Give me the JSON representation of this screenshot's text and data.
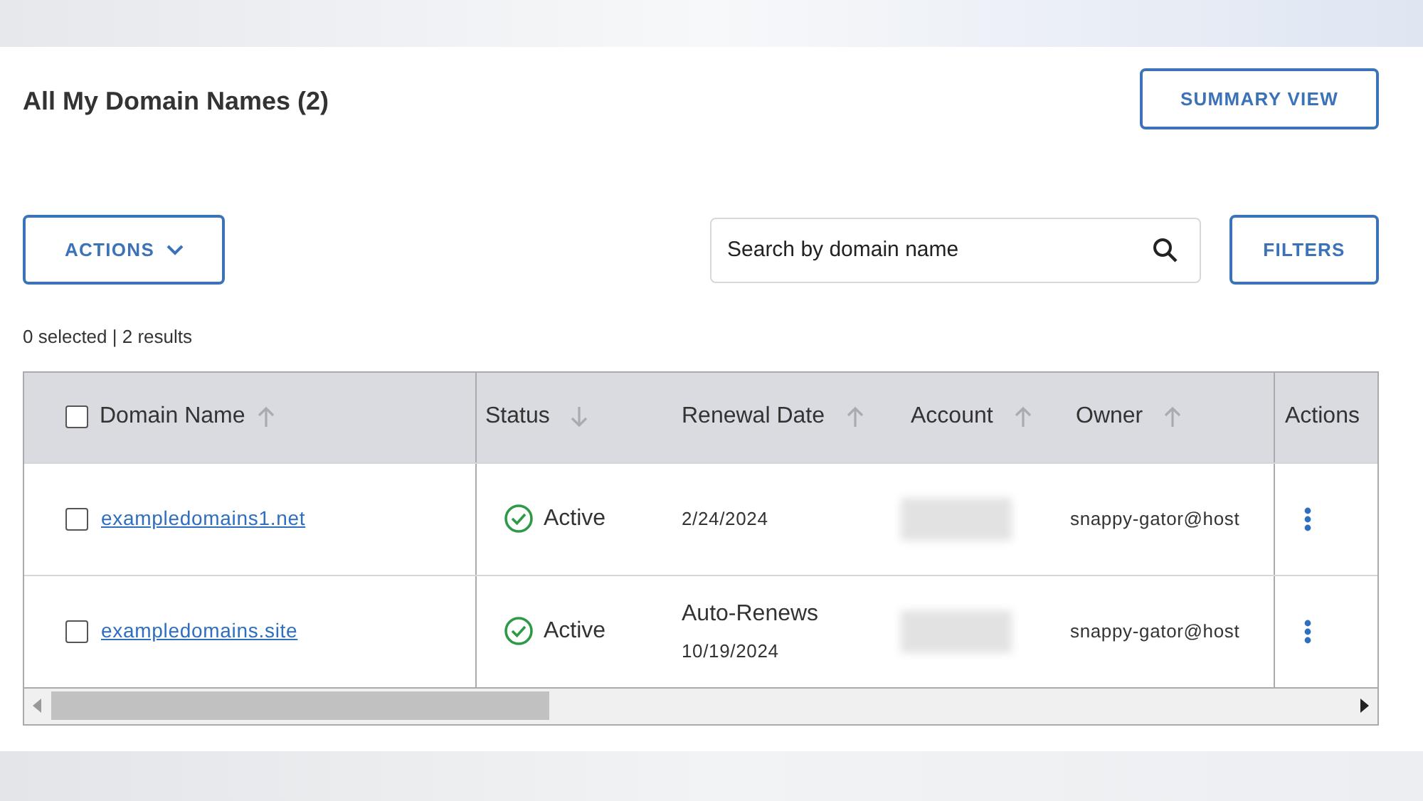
{
  "header": {
    "title": "All My Domain Names (2)",
    "summary_button": "SUMMARY VIEW"
  },
  "toolbar": {
    "actions_button": "ACTIONS",
    "search": {
      "placeholder": "Search by domain name"
    },
    "filters_button": "FILTERS"
  },
  "result_summary": "0 selected | 2 results",
  "table": {
    "select_all": {
      "checked": false
    },
    "columns": [
      {
        "label": "Domain Name",
        "sortable": true,
        "descending": false
      },
      {
        "label": "Status",
        "sortable": true,
        "descending": true
      },
      {
        "label": "Renewal Date",
        "sortable": true,
        "descending": false
      },
      {
        "label": "Account",
        "sortable": true,
        "descending": false
      },
      {
        "label": "Owner",
        "sortable": true,
        "descending": false
      },
      {
        "label": "Actions"
      }
    ],
    "rows": [
      {
        "checked": false,
        "domain": "exampledomains1.net",
        "status": "Active",
        "renewal_note": null,
        "renewal_date": "2/24/2024",
        "owner": "snappy-gator@host"
      },
      {
        "checked": false,
        "domain": "exampledomains.site",
        "status": "Active",
        "renewal_note": "Auto-Renews",
        "renewal_date": "10/19/2024",
        "owner": "snappy-gator@host"
      }
    ]
  }
}
